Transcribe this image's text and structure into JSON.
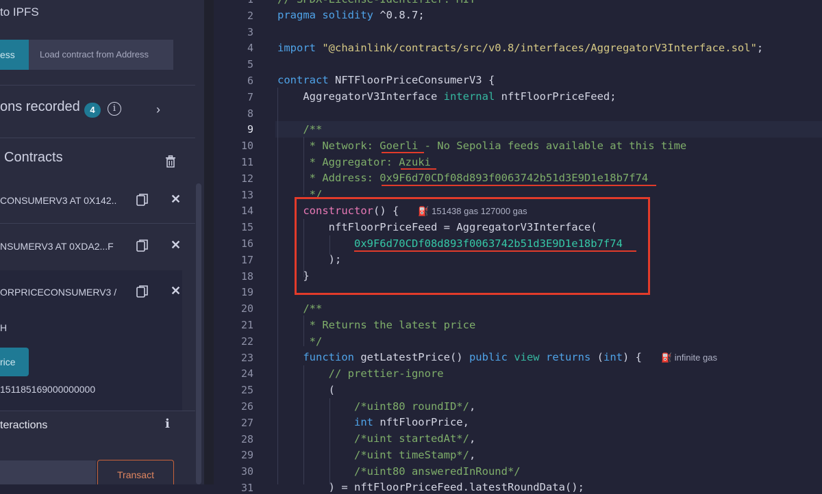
{
  "left_panel": {
    "publish_ipfs": "to IPFS",
    "at_address_label": "ess",
    "load_address_placeholder": "Load contract from Address",
    "transactions_recorded": "ons recorded",
    "transactions_count": "4",
    "deployed_contracts_title": "Contracts",
    "contracts": [
      {
        "label": "CONSUMERV3 AT 0X142...3"
      },
      {
        "label": "NSUMERV3 AT 0XDA2...F"
      },
      {
        "label": "ORPRICECONSUMERV3 /"
      }
    ],
    "balance_label": "H",
    "get_price_label": "rice",
    "price_value": "151185169000000000",
    "low_level_title": "teractions",
    "transact_label": "Transact"
  },
  "editor": {
    "line_numbers": [
      "1",
      "2",
      "3",
      "4",
      "5",
      "6",
      "7",
      "8",
      "9",
      "10",
      "11",
      "12",
      "13",
      "14",
      "15",
      "16",
      "17",
      "18",
      "19",
      "20",
      "21",
      "22",
      "23",
      "24",
      "25",
      "26",
      "27",
      "28",
      "29",
      "30",
      "31"
    ],
    "active_line": "9",
    "gas_constructor": "151438 gas 127000 gas",
    "gas_function": "infinite gas"
  },
  "colors": {
    "accent": "#1f7a95",
    "highlight_red": "#e23b2a",
    "transact_orange": "#c9643b"
  }
}
